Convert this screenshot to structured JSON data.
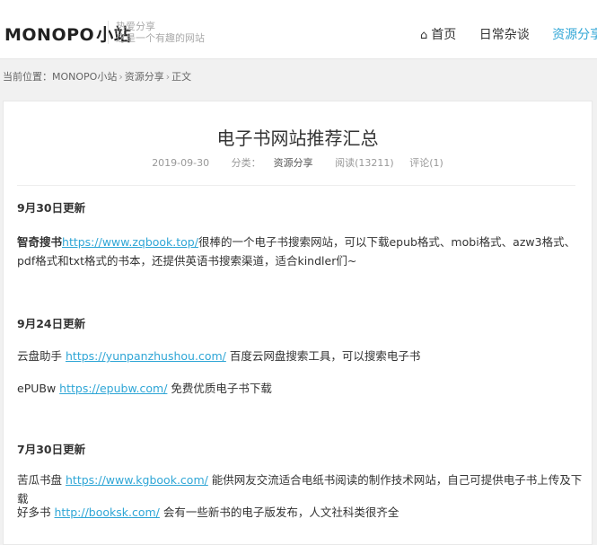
{
  "header": {
    "logo_text": "MONOPO",
    "logo_cn": "小站",
    "tagline1": "热爱分享",
    "tagline2": "这是一个有趣的网站",
    "nav": [
      {
        "label": "首页",
        "icon": "home-icon"
      },
      {
        "label": "日常杂谈"
      },
      {
        "label": "资源分享"
      }
    ]
  },
  "breadcrumb": {
    "prefix": "当前位置：",
    "items": [
      "MONOPO小站",
      "资源分享",
      "正文"
    ]
  },
  "article": {
    "title": "电子书网站推荐汇总",
    "date": "2019-09-30",
    "category_prefix": "分类：",
    "category": "资源分享",
    "views": "阅读(13211)",
    "comments": "评论(1)",
    "sections": [
      {
        "heading": "9月30日更新",
        "entries": [
          {
            "name": "智奇搜书",
            "url": "https://www.zqbook.top/",
            "desc": "很棒的一个电子书搜索网站，可以下载epub格式、mobi格式、azw3格式、pdf格式和txt格式的书本，还提供英语书搜索渠道，适合kindler们~"
          }
        ]
      },
      {
        "heading": "9月24日更新",
        "entries": [
          {
            "name": "云盘助手",
            "url": "https://yunpanzhushou.com/",
            "desc": " 百度云网盘搜索工具，可以搜索电子书"
          },
          {
            "name": "ePUBw",
            "url": "https://epubw.com/",
            "desc": " 免费优质电子书下载"
          }
        ]
      },
      {
        "heading": "7月30日更新",
        "entries": [
          {
            "name": "苦瓜书盘",
            "url": "https://www.kgbook.com/",
            "desc": " 能供网友交流适合电纸书阅读的制作技术网站，自己可提供电子书上传及下载"
          },
          {
            "name": "好多书",
            "url": "http://booksk.com/",
            "desc": " 会有一些新书的电子版发布，人文社科类很齐全"
          }
        ]
      }
    ]
  }
}
